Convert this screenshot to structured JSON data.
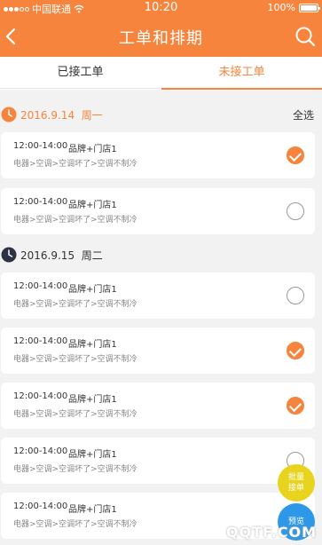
{
  "status_bar": {
    "carrier": "中国联通",
    "time": "10:20",
    "battery": "100%"
  },
  "nav": {
    "title": "工单和排期"
  },
  "tabs": [
    {
      "label": "已接工单",
      "active": false
    },
    {
      "label": "未接工单",
      "active": true
    }
  ],
  "colors": {
    "accent": "#f7843c",
    "fab_yellow": "#e8d41e",
    "fab_blue": "#2e98e8"
  },
  "groups": [
    {
      "date": "2016.9.14",
      "weekday": "周一",
      "select_all": "全选",
      "icon": "clock-icon",
      "items": [
        {
          "time": "12:00-14:00",
          "store": "品牌+门店1",
          "path": "电器>空调>空调坏了>空调不制冷",
          "checked": true
        },
        {
          "time": "12:00-14:00",
          "store": "品牌+门店1",
          "path": "电器>空调>空调坏了>空调不制冷",
          "checked": false
        }
      ]
    },
    {
      "date": "2016.9.15",
      "weekday": "周二",
      "icon": "clock-icon",
      "items": [
        {
          "time": "12:00-14:00",
          "store": "品牌+门店1",
          "path": "电器>空调>空调坏了>空调不制冷",
          "checked": false
        },
        {
          "time": "12:00-14:00",
          "store": "品牌+门店1",
          "path": "电器>空调>空调坏了>空调不制冷",
          "checked": true
        },
        {
          "time": "12:00-14:00",
          "store": "品牌+门店1",
          "path": "电器>空调>空调坏了>空调不制冷",
          "checked": true
        },
        {
          "time": "12:00-14:00",
          "store": "品牌+门店1",
          "path": "电器>空调>空调坏了>空调不制冷",
          "checked": false
        },
        {
          "time": "12:00-14:00",
          "store": "品牌+门店1",
          "path": "电器>空调>空调坏了>空调不制冷",
          "checked": false
        }
      ]
    }
  ],
  "fabs": {
    "batch_line1": "批量",
    "batch_line2": "接单",
    "preview": "预览"
  },
  "watermark": "QQTF.COM"
}
